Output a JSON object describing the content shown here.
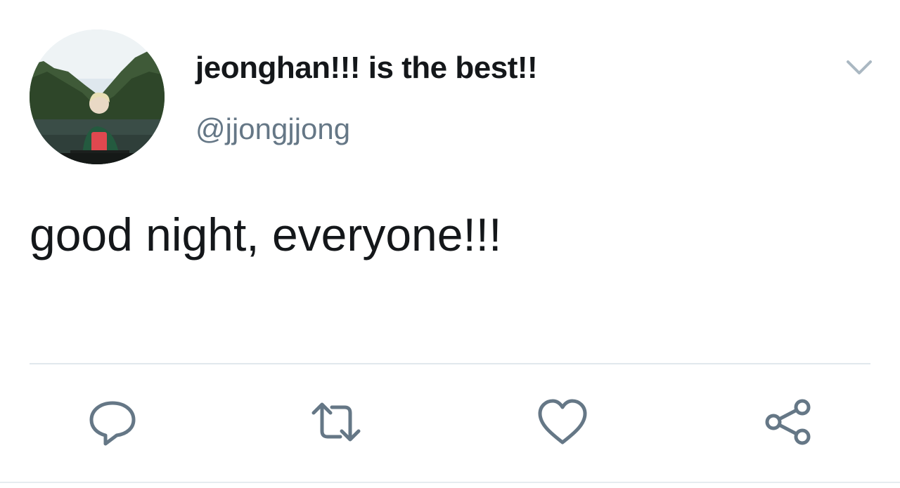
{
  "tweet": {
    "display_name": "jeonghan!!! is the best!!",
    "handle": "@jjongjjong",
    "text": "good night, everyone!!!"
  },
  "icons": {
    "caret": "chevron-down-icon",
    "reply": "reply-icon",
    "retweet": "retweet-icon",
    "like": "heart-icon",
    "share": "share-icon"
  },
  "colors": {
    "primary_text": "#14171a",
    "secondary_text": "#657786",
    "icon_gray": "#657786",
    "divider": "#e1e8ed"
  }
}
